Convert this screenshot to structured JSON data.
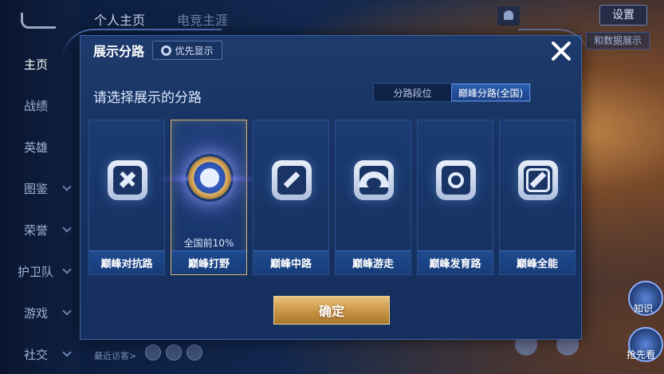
{
  "background": {
    "top_tabs": [
      "个人主页",
      "电竞主涯"
    ],
    "nav_items": [
      {
        "label": "主页",
        "active": true
      },
      {
        "label": "战绩",
        "active": false
      },
      {
        "label": "英雄",
        "active": false
      },
      {
        "label": "图鉴",
        "active": false
      },
      {
        "label": "荣誉",
        "active": false
      },
      {
        "label": "护卫队",
        "active": false
      },
      {
        "label": "游戏",
        "active": false
      },
      {
        "label": "社交",
        "active": false
      }
    ],
    "settings_label": "设置",
    "data_display_label": "和数据展示",
    "recent_visitors_label": "最近访客>",
    "side_buttons": [
      "知识",
      "抢先看"
    ]
  },
  "modal": {
    "title": "展示分路",
    "priority_button_label": "优先显示",
    "subtitle": "请选择展示的分路",
    "segment_options": [
      {
        "label": "分路段位",
        "active": false
      },
      {
        "label": "巅峰分路(全国)",
        "active": true
      }
    ],
    "lanes": [
      {
        "label": "巅峰对抗路",
        "icon": "clash-lane-icon",
        "selected": false,
        "rank": ""
      },
      {
        "label": "巅峰打野",
        "icon": "jungle-emblem-icon",
        "selected": true,
        "rank": "全国前10%"
      },
      {
        "label": "巅峰中路",
        "icon": "mid-lane-icon",
        "selected": false,
        "rank": ""
      },
      {
        "label": "巅峰游走",
        "icon": "roam-icon",
        "selected": false,
        "rank": ""
      },
      {
        "label": "巅峰发育路",
        "icon": "farm-lane-icon",
        "selected": false,
        "rank": ""
      },
      {
        "label": "巅峰全能",
        "icon": "all-round-icon",
        "selected": false,
        "rank": ""
      }
    ],
    "confirm_label": "确定"
  },
  "colors": {
    "modal_bg": "#173262",
    "selected_border": "#d9b66b",
    "confirm_gold": "#c99444",
    "segment_active": "#2c5dae"
  }
}
